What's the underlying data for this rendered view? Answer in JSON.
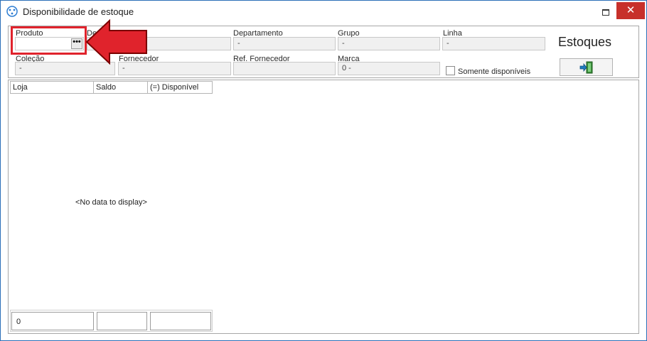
{
  "window": {
    "title": "Disponibilidade de estoque",
    "close_glyph": "✕"
  },
  "filters": {
    "produto_label": "Produto",
    "produto_value": "",
    "ellipsis_label": "•••",
    "descricao_label": "De",
    "descricao_value": "",
    "departamento_label": "Departamento",
    "departamento_value": "-",
    "grupo_label": "Grupo",
    "grupo_value": "-",
    "linha_label": "Linha",
    "linha_value": "-",
    "colecao_label": "Coleção",
    "colecao_value": "-",
    "fornecedor_label": "Fornecedor",
    "fornecedor_value": "-",
    "ref_fornecedor_label": "Ref. Fornecedor",
    "ref_fornecedor_value": "",
    "marca_label": "Marca",
    "marca_value": "0 -",
    "somente_disponiveis_label": "Somente disponíveis",
    "somente_disponiveis_checked": false
  },
  "estoques": {
    "title": "Estoques",
    "exit_icon": "exit-door-icon"
  },
  "grid": {
    "columns": [
      "Loja",
      "Saldo",
      "(=) Disponível"
    ],
    "empty_text": "<No data to display>",
    "footer": [
      "0",
      "",
      ""
    ]
  },
  "colors": {
    "highlight": "#e0232c",
    "close_button": "#c7302a",
    "window_border": "#2b6fb8"
  }
}
